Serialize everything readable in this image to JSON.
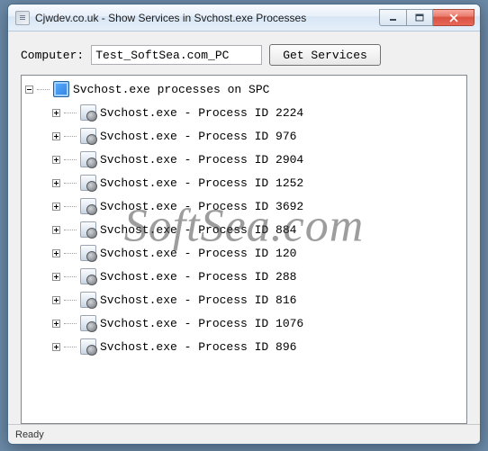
{
  "window": {
    "title": "Cjwdev.co.uk - Show Services in Svchost.exe Processes"
  },
  "input": {
    "computer_label": "Computer:",
    "computer_value": "Test_SoftSea.com_PC",
    "get_button": "Get Services"
  },
  "tree": {
    "root_label": "Svchost.exe processes on SPC",
    "items": [
      {
        "label": "Svchost.exe - Process ID 2224"
      },
      {
        "label": "Svchost.exe - Process ID 976"
      },
      {
        "label": "Svchost.exe - Process ID 2904"
      },
      {
        "label": "Svchost.exe - Process ID 1252"
      },
      {
        "label": "Svchost.exe - Process ID 3692"
      },
      {
        "label": "Svchost.exe - Process ID 884"
      },
      {
        "label": "Svchost.exe - Process ID 120"
      },
      {
        "label": "Svchost.exe - Process ID 288"
      },
      {
        "label": "Svchost.exe - Process ID 816"
      },
      {
        "label": "Svchost.exe - Process ID 1076"
      },
      {
        "label": "Svchost.exe - Process ID 896"
      }
    ]
  },
  "status": {
    "text": "Ready"
  },
  "watermark": "SoftSea.com"
}
